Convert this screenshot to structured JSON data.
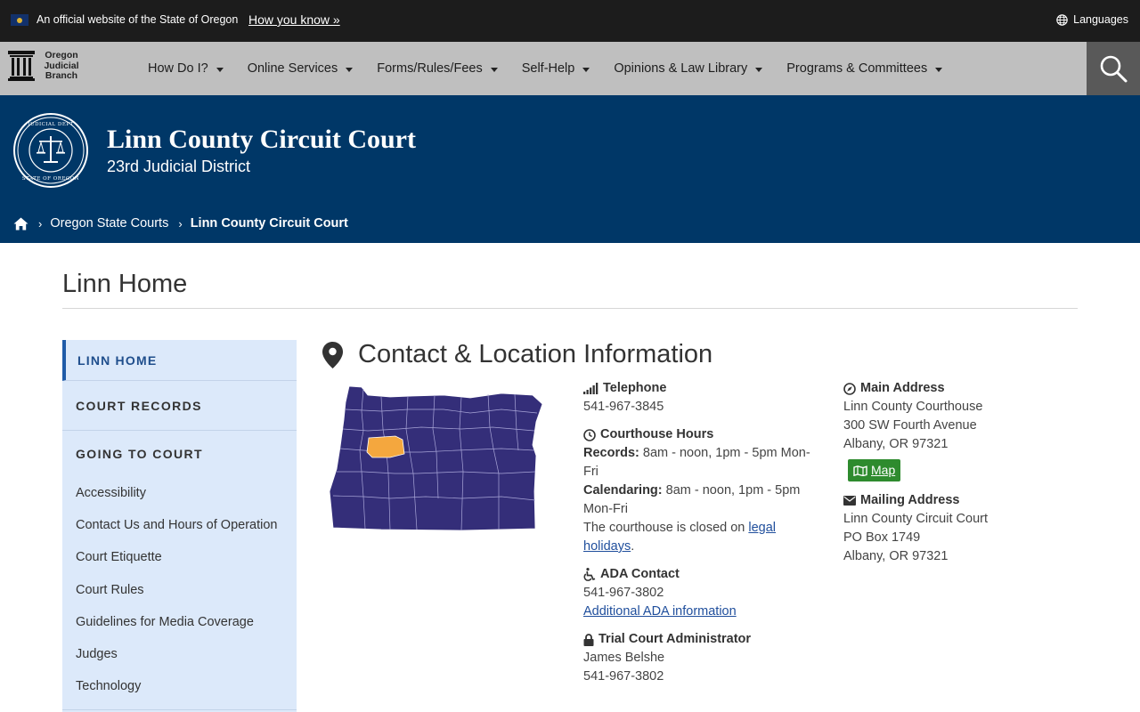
{
  "official_bar": {
    "text": "An official website of the State of Oregon",
    "how_you_know": "How you know »",
    "languages": "Languages"
  },
  "nav": {
    "logo_text": [
      "Oregon",
      "Judicial",
      "Branch"
    ],
    "items": [
      {
        "label": "How Do I?"
      },
      {
        "label": "Online Services"
      },
      {
        "label": "Forms/Rules/Fees"
      },
      {
        "label": "Self-Help"
      },
      {
        "label": "Opinions & Law Library"
      },
      {
        "label": "Programs & Committees"
      }
    ]
  },
  "header": {
    "title": "Linn County Circuit Court",
    "subtitle": "23rd Judicial District",
    "seal_text": "JUDICIAL DEPARTMENT · STATE OF OREGON"
  },
  "breadcrumb": {
    "items": [
      "Oregon State Courts",
      "Linn County Circuit Court"
    ]
  },
  "page": {
    "title": "Linn Home"
  },
  "sidebar": {
    "active": "LINN HOME",
    "records": "COURT RECORDS",
    "group_heading": "GOING TO COURT",
    "links": [
      "Accessibility",
      "Contact Us and Hours of Operation",
      "Court Etiquette",
      "Court Rules",
      "Guidelines for Media Coverage",
      "Judges",
      "Technology"
    ]
  },
  "contact": {
    "heading": "Contact & Location Information",
    "telephone": {
      "label": "Telephone",
      "value": "541-967-3845"
    },
    "hours": {
      "label": "Courthouse Hours",
      "records_label": "Records:",
      "records_value": " 8am - noon, 1pm - 5pm Mon-Fri",
      "calendaring_label": "Calendaring:",
      "calendaring_value": " 8am - noon, 1pm - 5pm Mon-Fri",
      "closed_text": "The courthouse is closed on ",
      "closed_link": "legal holidays",
      "closed_end": "."
    },
    "ada": {
      "label": "ADA Contact",
      "phone": "541-967-3802",
      "link": "Additional ADA information"
    },
    "tca": {
      "label": "Trial Court Administrator",
      "name": "James Belshe",
      "phone": "541-967-3802"
    },
    "main_address": {
      "label": "Main Address",
      "line1": "Linn County Courthouse",
      "line2": "300 SW Fourth Avenue",
      "line3": "Albany, OR 97321",
      "map_button": "Map"
    },
    "mailing_address": {
      "label": "Mailing Address",
      "line1": "Linn County Circuit Court",
      "line2": "PO Box 1749",
      "line3": "Albany, OR 97321"
    }
  },
  "colors": {
    "banner": "#003767",
    "nav": "#bfbfbf",
    "sidebar": "#dce9fa",
    "map_fill": "#342e79",
    "map_highlight": "#f4a73e",
    "map_button": "#2e8b2e"
  }
}
